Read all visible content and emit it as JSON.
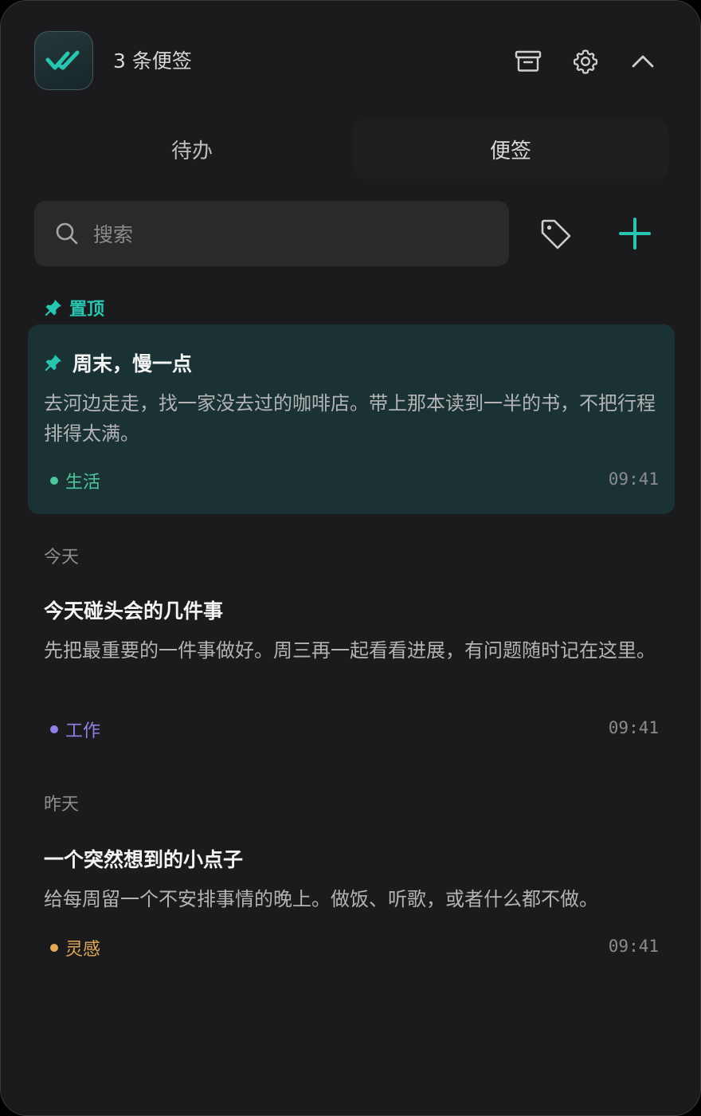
{
  "header": {
    "count_label": "3 条便签",
    "icons": {
      "logo": "double-check-icon",
      "archive": "archive-icon",
      "settings": "gear-icon",
      "collapse": "chevron-up-icon"
    }
  },
  "tabs": [
    {
      "label": "待办",
      "active": false
    },
    {
      "label": "便签",
      "active": true
    }
  ],
  "search": {
    "placeholder": "搜索",
    "value": ""
  },
  "toolbar": {
    "tag_icon": "tag-icon",
    "add_icon": "plus-icon"
  },
  "sections": {
    "pinned": "置顶",
    "today": "今天",
    "yesterday": "昨天"
  },
  "notes": [
    {
      "title": "周末，慢一点",
      "body": "去河边走走，找一家没去过的咖啡店。带上那本读到一半的书，不把行程排得太满。",
      "tag": "生活",
      "tag_color": "#4ec59a",
      "time": "09:41",
      "pinned": true
    },
    {
      "title": "今天碰头会的几件事",
      "body": "先把最重要的一件事做好。周三再一起看看进展，有问题随时记在这里。",
      "tag": "工作",
      "tag_color": "#8f82e6",
      "time": "09:41",
      "pinned": false
    },
    {
      "title": "一个突然想到的小点子",
      "body": "给每周留一个不安排事情的晚上。做饭、听歌，或者什么都不做。",
      "tag": "灵感",
      "tag_color": "#e3a955",
      "time": "09:41",
      "pinned": false
    }
  ],
  "colors": {
    "accent": "#27c6b0",
    "background": "#1b1b1d",
    "pinned_card": "#1a3233"
  }
}
